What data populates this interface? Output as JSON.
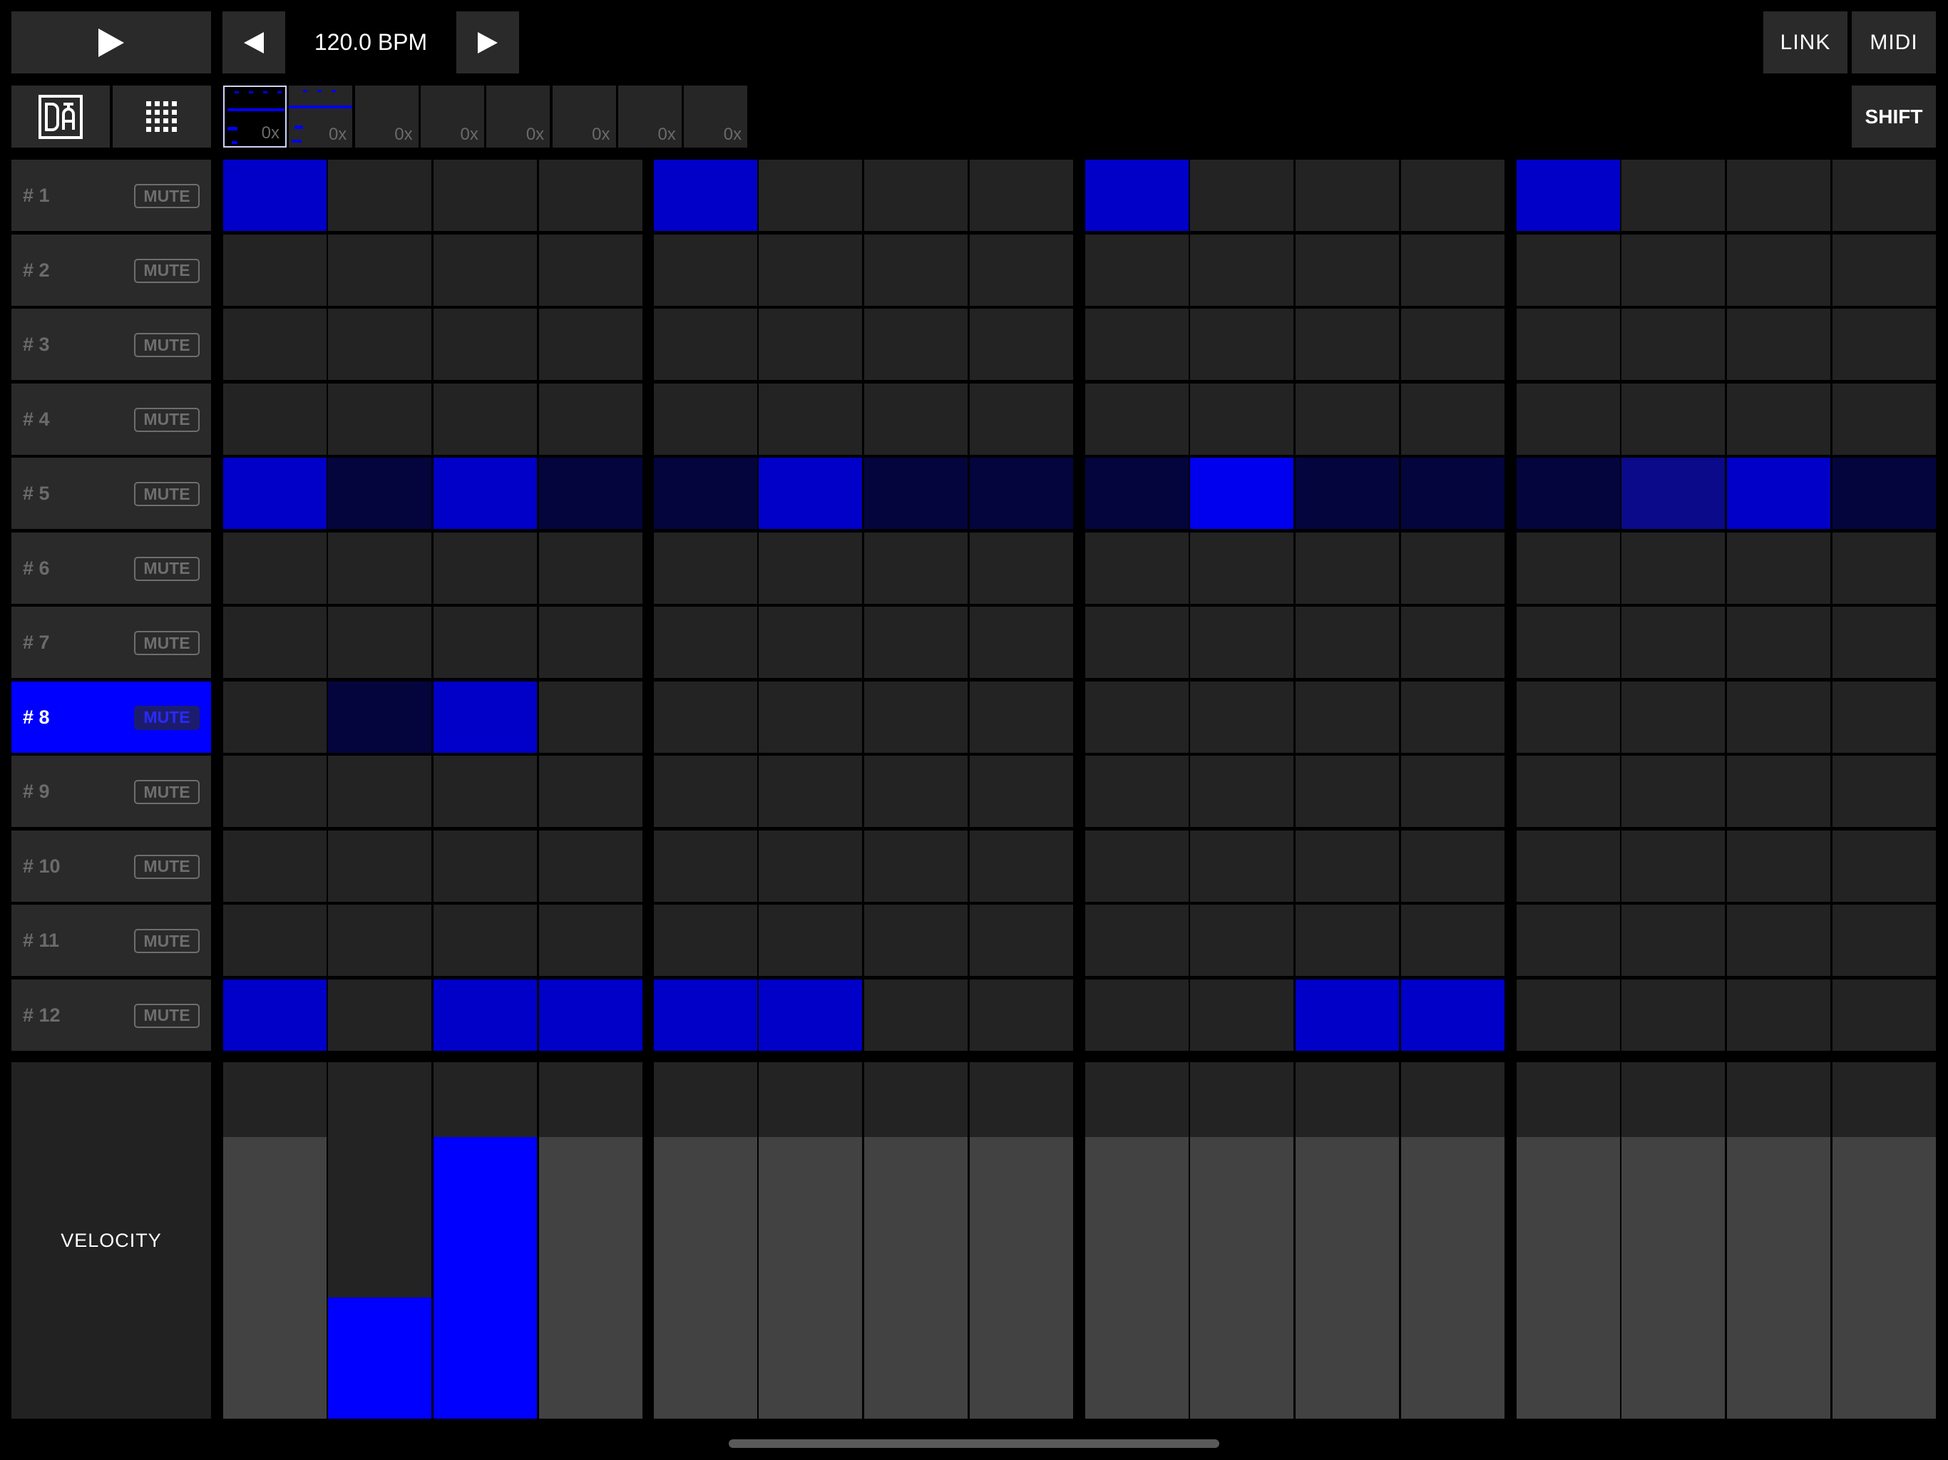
{
  "transport": {
    "bpm_label": "120.0 BPM",
    "play_icon": "play-icon",
    "prev_icon": "triangle-left-icon",
    "next_icon": "triangle-right-icon"
  },
  "header": {
    "link_label": "LINK",
    "midi_label": "MIDI",
    "shift_label": "SHIFT"
  },
  "patterns": [
    {
      "label": "0x",
      "selected": true
    },
    {
      "label": "0x",
      "selected": false
    },
    {
      "label": "0x",
      "selected": false
    },
    {
      "label": "0x",
      "selected": false
    },
    {
      "label": "0x",
      "selected": false
    },
    {
      "label": "0x",
      "selected": false
    },
    {
      "label": "0x",
      "selected": false
    },
    {
      "label": "0x",
      "selected": false
    }
  ],
  "tracks": [
    {
      "name": "# 1",
      "mute": "MUTE",
      "selected": false
    },
    {
      "name": "# 2",
      "mute": "MUTE",
      "selected": false
    },
    {
      "name": "# 3",
      "mute": "MUTE",
      "selected": false
    },
    {
      "name": "# 4",
      "mute": "MUTE",
      "selected": false
    },
    {
      "name": "# 5",
      "mute": "MUTE",
      "selected": false
    },
    {
      "name": "# 6",
      "mute": "MUTE",
      "selected": false
    },
    {
      "name": "# 7",
      "mute": "MUTE",
      "selected": false
    },
    {
      "name": "# 8",
      "mute": "MUTE",
      "selected": true
    },
    {
      "name": "# 9",
      "mute": "MUTE",
      "selected": false
    },
    {
      "name": "# 10",
      "mute": "MUTE",
      "selected": false
    },
    {
      "name": "# 11",
      "mute": "MUTE",
      "selected": false
    },
    {
      "name": "# 12",
      "mute": "MUTE",
      "selected": false
    }
  ],
  "step_grid": [
    [
      3,
      0,
      0,
      0,
      3,
      0,
      0,
      0,
      3,
      0,
      0,
      0,
      3,
      0,
      0,
      0
    ],
    [
      0,
      0,
      0,
      0,
      0,
      0,
      0,
      0,
      0,
      0,
      0,
      0,
      0,
      0,
      0,
      0
    ],
    [
      0,
      0,
      0,
      0,
      0,
      0,
      0,
      0,
      0,
      0,
      0,
      0,
      0,
      0,
      0,
      0
    ],
    [
      0,
      0,
      0,
      0,
      0,
      0,
      0,
      0,
      0,
      0,
      0,
      0,
      0,
      0,
      0,
      0
    ],
    [
      3,
      1,
      3,
      1,
      1,
      3,
      1,
      1,
      1,
      4,
      1,
      1,
      1,
      2,
      3,
      1
    ],
    [
      0,
      0,
      0,
      0,
      0,
      0,
      0,
      0,
      0,
      0,
      0,
      0,
      0,
      0,
      0,
      0
    ],
    [
      0,
      0,
      0,
      0,
      0,
      0,
      0,
      0,
      0,
      0,
      0,
      0,
      0,
      0,
      0,
      0
    ],
    [
      0,
      1,
      3,
      0,
      0,
      0,
      0,
      0,
      0,
      0,
      0,
      0,
      0,
      0,
      0,
      0
    ],
    [
      0,
      0,
      0,
      0,
      0,
      0,
      0,
      0,
      0,
      0,
      0,
      0,
      0,
      0,
      0,
      0
    ],
    [
      0,
      0,
      0,
      0,
      0,
      0,
      0,
      0,
      0,
      0,
      0,
      0,
      0,
      0,
      0,
      0
    ],
    [
      0,
      0,
      0,
      0,
      0,
      0,
      0,
      0,
      0,
      0,
      0,
      0,
      0,
      0,
      0,
      0
    ],
    [
      3,
      0,
      3,
      3,
      3,
      3,
      0,
      0,
      0,
      0,
      3,
      3,
      0,
      0,
      0,
      0
    ]
  ],
  "level_colors": [
    "#232323",
    "#05053d",
    "#0a0a8a",
    "#0000c8",
    "#0000ee"
  ],
  "velocity": {
    "label": "VELOCITY",
    "steps": [
      {
        "level": 0.79,
        "active": false
      },
      {
        "level": 0.34,
        "active": true
      },
      {
        "level": 0.79,
        "active": true
      },
      {
        "level": 0.79,
        "active": false
      },
      {
        "level": 0.79,
        "active": false
      },
      {
        "level": 0.79,
        "active": false
      },
      {
        "level": 0.79,
        "active": false
      },
      {
        "level": 0.79,
        "active": false
      },
      {
        "level": 0.79,
        "active": false
      },
      {
        "level": 0.79,
        "active": false
      },
      {
        "level": 0.79,
        "active": false
      },
      {
        "level": 0.79,
        "active": false
      },
      {
        "level": 0.79,
        "active": false
      },
      {
        "level": 0.79,
        "active": false
      },
      {
        "level": 0.79,
        "active": false
      },
      {
        "level": 0.79,
        "active": false
      }
    ],
    "active_color": "#0000ff",
    "inactive_color": "#424242"
  }
}
